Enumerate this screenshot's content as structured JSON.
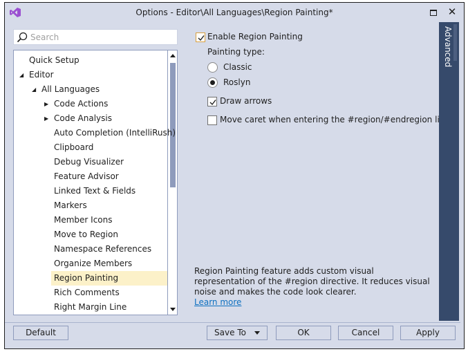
{
  "window": {
    "title": "Options - Editor\\All Languages\\Region Painting*",
    "logo_icon": "visual-studio-logo-icon",
    "maximize_icon": "maximize-icon",
    "close_icon": "close-icon",
    "close_glyph": "✕"
  },
  "search": {
    "placeholder": "Search",
    "value": "",
    "icon": "search-icon"
  },
  "tree": {
    "items": [
      {
        "label": "Quick Setup",
        "level": 0,
        "expander": "none",
        "selected": false
      },
      {
        "label": "Editor",
        "level": 0,
        "expander": "expanded",
        "selected": false
      },
      {
        "label": "All Languages",
        "level": 1,
        "expander": "expanded",
        "selected": false
      },
      {
        "label": "Code Actions",
        "level": 2,
        "expander": "collapsed",
        "selected": false
      },
      {
        "label": "Code Analysis",
        "level": 2,
        "expander": "collapsed",
        "selected": false
      },
      {
        "label": "Auto Completion (IntelliRush)",
        "level": 2,
        "expander": "none",
        "selected": false
      },
      {
        "label": "Clipboard",
        "level": 2,
        "expander": "none",
        "selected": false
      },
      {
        "label": "Debug Visualizer",
        "level": 2,
        "expander": "none",
        "selected": false
      },
      {
        "label": "Feature Advisor",
        "level": 2,
        "expander": "none",
        "selected": false
      },
      {
        "label": "Linked Text & Fields",
        "level": 2,
        "expander": "none",
        "selected": false
      },
      {
        "label": "Markers",
        "level": 2,
        "expander": "none",
        "selected": false
      },
      {
        "label": "Member Icons",
        "level": 2,
        "expander": "none",
        "selected": false
      },
      {
        "label": "Move to Region",
        "level": 2,
        "expander": "none",
        "selected": false
      },
      {
        "label": "Namespace References",
        "level": 2,
        "expander": "none",
        "selected": false
      },
      {
        "label": "Organize Members",
        "level": 2,
        "expander": "none",
        "selected": false
      },
      {
        "label": "Region Painting",
        "level": 2,
        "expander": "none",
        "selected": true
      },
      {
        "label": "Rich Comments",
        "level": 2,
        "expander": "none",
        "selected": false
      },
      {
        "label": "Right Margin Line",
        "level": 2,
        "expander": "none",
        "selected": false
      }
    ],
    "expander_glyphs": {
      "expanded": "◢",
      "collapsed": "▶"
    }
  },
  "settings": {
    "enable_region_painting": {
      "label": "Enable Region Painting",
      "checked": true
    },
    "painting_type_label": "Painting type:",
    "painting_types": [
      {
        "label": "Classic",
        "selected": false
      },
      {
        "label": "Roslyn",
        "selected": true
      }
    ],
    "draw_arrows": {
      "label": "Draw arrows",
      "checked": true
    },
    "move_caret": {
      "label": "Move caret when entering the #region/#endregion line",
      "checked": false
    }
  },
  "advanced_tab": {
    "label": "Advanced"
  },
  "description": {
    "text": "Region Painting feature adds custom visual representation of the #region directive. It reduces visual noise and makes the code look clearer.",
    "link": "Learn more"
  },
  "buttons": {
    "default": "Default",
    "save_to": "Save To",
    "ok": "OK",
    "cancel": "Cancel",
    "apply": "Apply"
  },
  "colors": {
    "background": "#d6dbe9",
    "selection": "#fcf1c9",
    "advanced_tab": "#364a6b",
    "link": "#0e70c0",
    "logo": "#9b4fd1"
  }
}
